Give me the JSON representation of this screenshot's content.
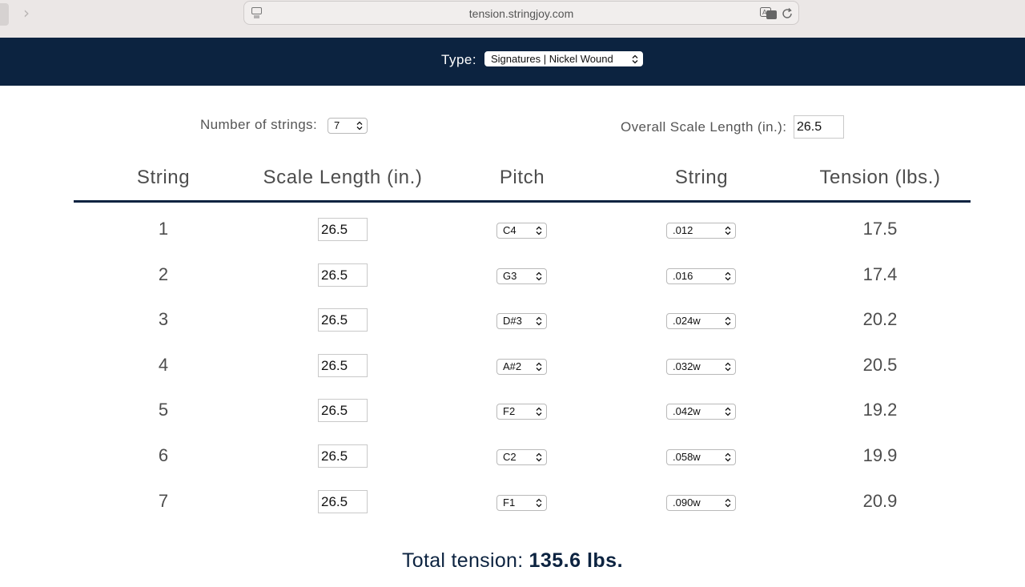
{
  "browser": {
    "url": "tension.stringjoy.com"
  },
  "header": {
    "type_label": "Type:",
    "type_value": "Signatures | Nickel Wound"
  },
  "settings": {
    "num_strings_label": "Number of strings:",
    "num_strings_value": "7",
    "scale_label": "Overall Scale Length (in.):",
    "scale_value": "26.5"
  },
  "table": {
    "headers": [
      "String",
      "Scale Length (in.)",
      "Pitch",
      "String",
      "Tension (lbs.)"
    ],
    "rows": [
      {
        "num": "1",
        "length": "26.5",
        "pitch": "C4",
        "gauge": ".012",
        "tension": "17.5"
      },
      {
        "num": "2",
        "length": "26.5",
        "pitch": "G3",
        "gauge": ".016",
        "tension": "17.4"
      },
      {
        "num": "3",
        "length": "26.5",
        "pitch": "D#3",
        "gauge": ".024w",
        "tension": "20.2"
      },
      {
        "num": "4",
        "length": "26.5",
        "pitch": "A#2",
        "gauge": ".032w",
        "tension": "20.5"
      },
      {
        "num": "5",
        "length": "26.5",
        "pitch": "F2",
        "gauge": ".042w",
        "tension": "19.2"
      },
      {
        "num": "6",
        "length": "26.5",
        "pitch": "C2",
        "gauge": ".058w",
        "tension": "19.9"
      },
      {
        "num": "7",
        "length": "26.5",
        "pitch": "F1",
        "gauge": ".090w",
        "tension": "20.9"
      }
    ]
  },
  "total": {
    "label": "Total tension:",
    "value": "135.6 lbs."
  },
  "colors": {
    "navy": "#0c2340",
    "chrome": "#ebe7e6"
  }
}
